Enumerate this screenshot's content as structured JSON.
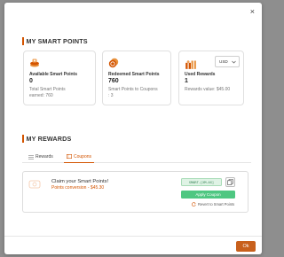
{
  "modal": {
    "close_label": "×"
  },
  "points": {
    "title": "MY SMART POINTS",
    "cards": [
      {
        "title": "Available Smart Points",
        "value": "0",
        "sub": "Total Smart Points earned: 760",
        "icon": "points-stack-icon"
      },
      {
        "title": "Redeemed Smart Points",
        "value": "760",
        "sub": "Smart Points to Coupons : 3",
        "icon": "coins-icon"
      },
      {
        "title": "Used Rewards",
        "value": "1",
        "sub": "Rewards value: $45.00",
        "icon": "gift-boxes-icon"
      }
    ],
    "currency": {
      "selected": "USD",
      "icon": "chevron-down-icon"
    }
  },
  "rewards": {
    "title": "MY REWARDS",
    "tabs": [
      {
        "label": "Rewards",
        "icon": "list-icon",
        "active": false
      },
      {
        "label": "Coupons",
        "icon": "ticket-icon",
        "active": true
      }
    ],
    "coupon": {
      "title": "Claim your Smart Points!",
      "subtitle": "Points conversion - $45.30",
      "code": "SMART-[XM-AS]",
      "apply_label": "Apply Coupon",
      "revert_label": "Revert to Smart Points",
      "icon": "coupon-icon"
    }
  },
  "footer": {
    "ok_label": "Ok"
  },
  "colors": {
    "accent": "#d35400",
    "button": "#c8601c",
    "success": "#4ec781"
  }
}
